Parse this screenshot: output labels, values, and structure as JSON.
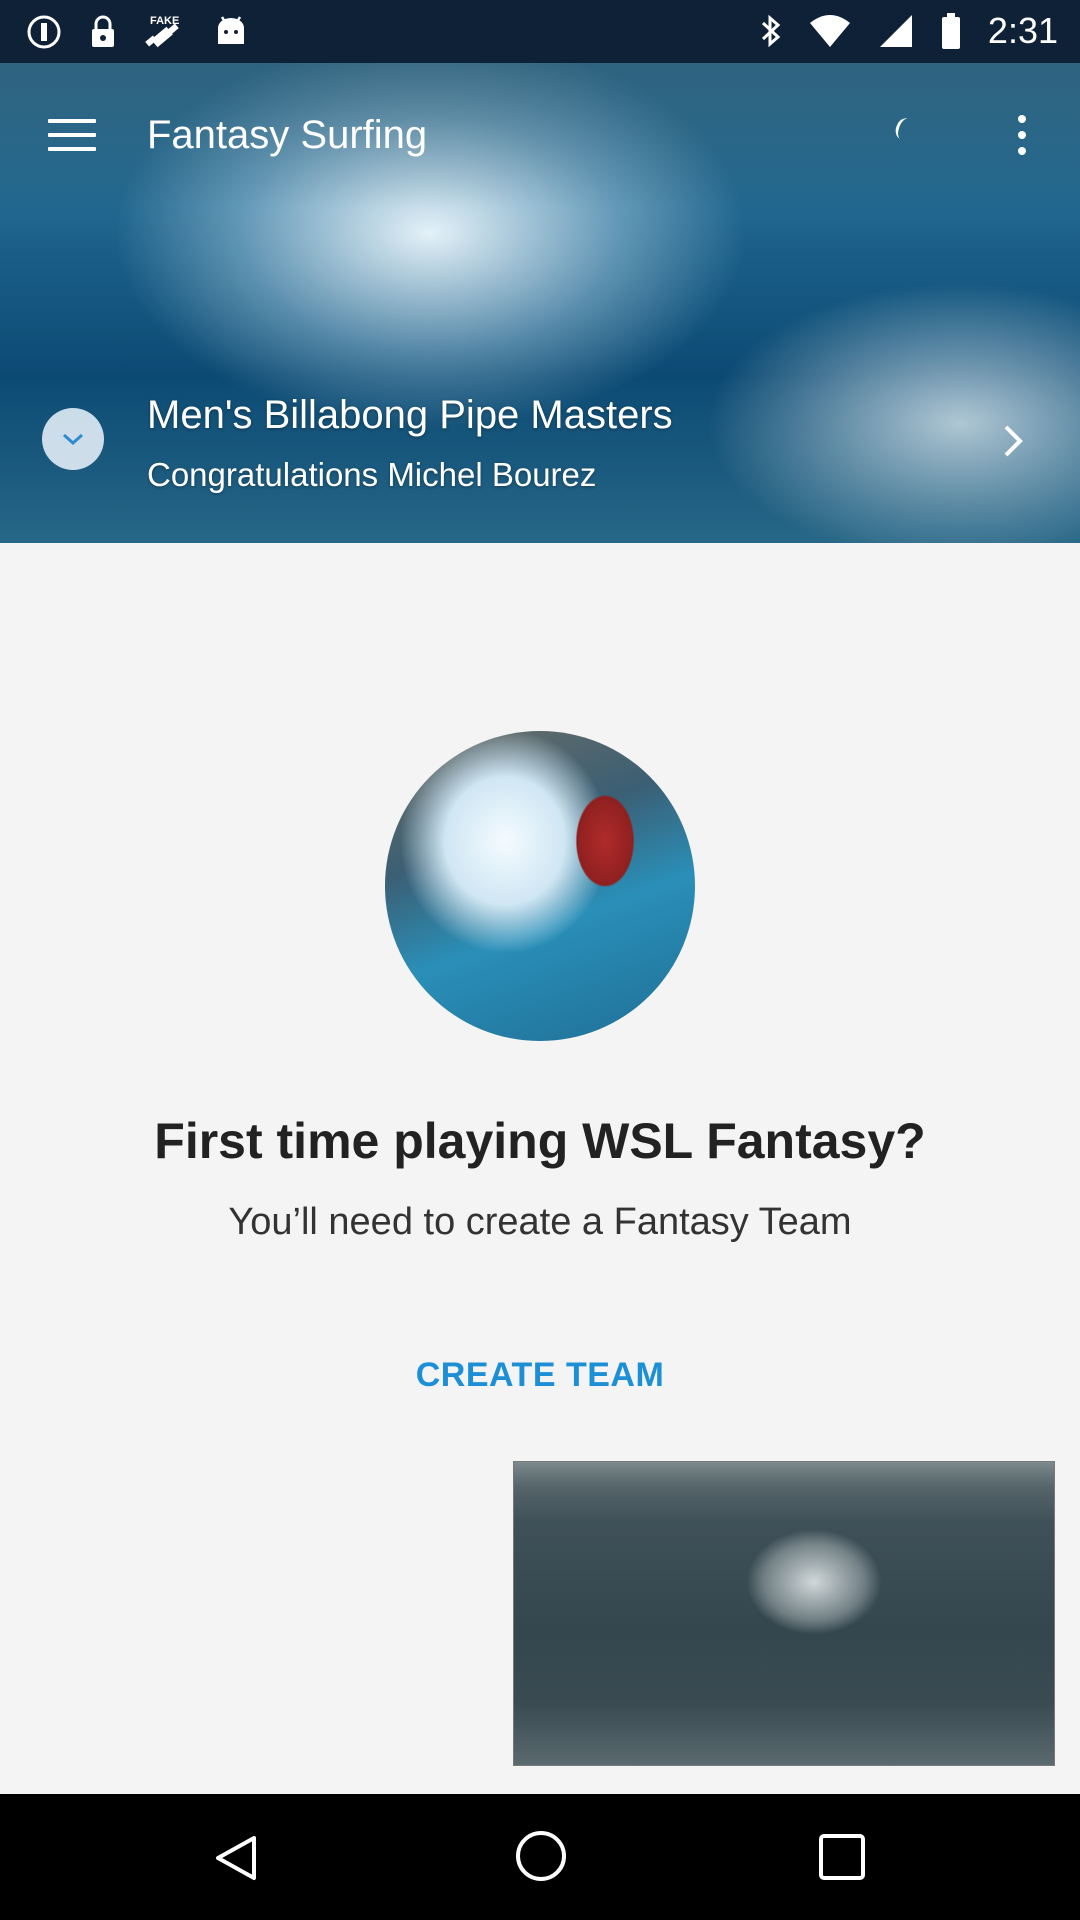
{
  "status_bar": {
    "time": "2:31",
    "icons": [
      "alert-circle-icon",
      "lock-icon",
      "fake-gps-icon",
      "android-icon",
      "bluetooth-icon",
      "wifi-icon",
      "signal-icon",
      "battery-icon"
    ]
  },
  "app_bar": {
    "title": "Fantasy Surfing",
    "menu_icon": "hamburger-menu-icon",
    "overflow_icon": "more-vert-icon"
  },
  "hero": {
    "event_title": "Men's Billabong Pipe Masters",
    "event_subtitle": "Congratulations Michel Bourez",
    "expand_icon": "chevron-down-icon",
    "next_icon": "chevron-right-icon"
  },
  "main": {
    "headline": "First time playing WSL Fantasy?",
    "subline": "You’ll need to create a Fantasy Team",
    "create_button_label": "CREATE TEAM"
  },
  "colors": {
    "accent": "#1d8fd6",
    "status_bar_bg": "#0f2137",
    "background": "#f4f4f4"
  },
  "nav_bar": {
    "icons": [
      "back-icon",
      "home-icon",
      "recent-apps-icon"
    ]
  }
}
